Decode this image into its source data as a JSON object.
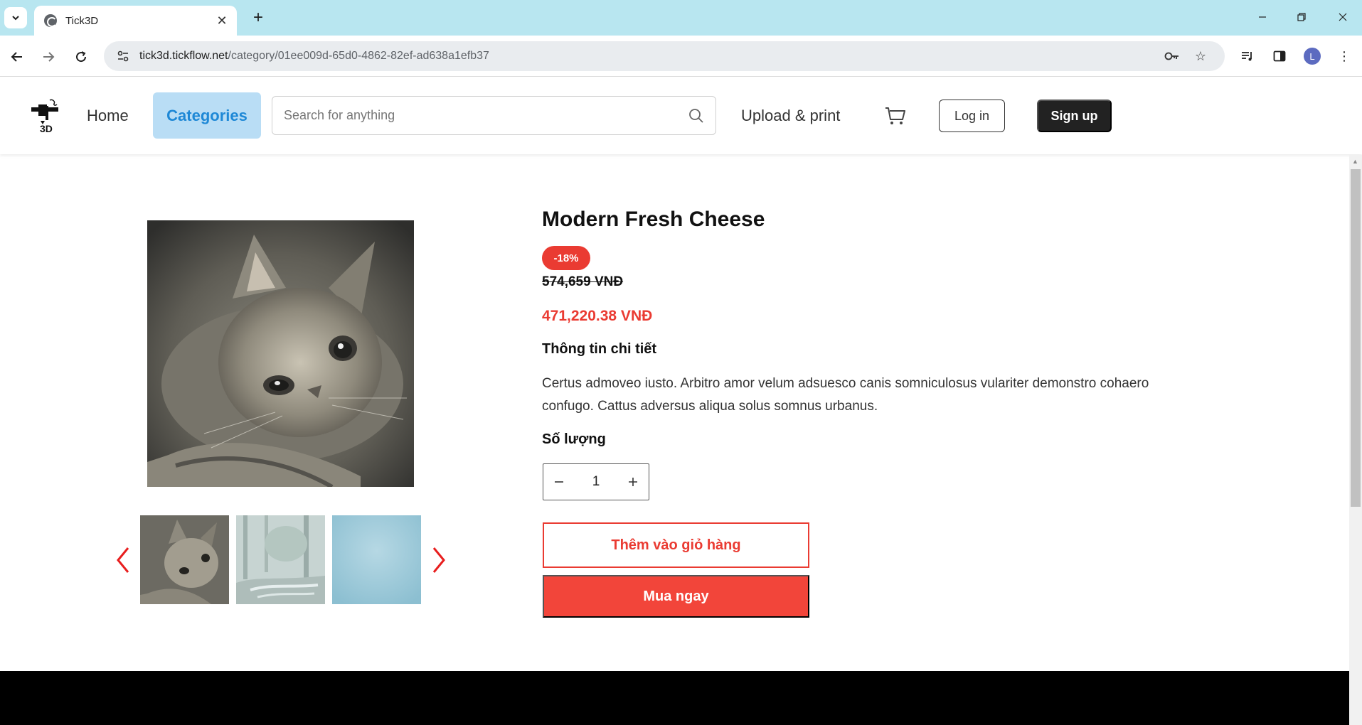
{
  "browser": {
    "tab_title": "Tick3D",
    "url_host": "tick3d.tickflow.net",
    "url_path": "/category/01ee009d-65d0-4862-82ef-ad638a1efb37",
    "profile_initial": "L"
  },
  "header": {
    "logo_text": "3D",
    "nav_home": "Home",
    "nav_categories": "Categories",
    "search_placeholder": "Search for anything",
    "upload_print": "Upload & print",
    "login": "Log in",
    "signup": "Sign up"
  },
  "product": {
    "title": "Modern Fresh Cheese",
    "discount_badge": "-18%",
    "old_price": "574,659 VNĐ",
    "new_price": "471,220.38 VNĐ",
    "detail_heading": "Thông tin chi tiết",
    "description": "Certus admoveo iusto. Arbitro amor velum adsuesco canis somniculosus vulariter demonstro cohaero confugo. Cattus adversus aliqua solus somnus urbanus.",
    "quantity_label": "Số lượng",
    "quantity_value": "1",
    "add_to_cart": "Thêm vào giỏ hàng",
    "buy_now": "Mua ngay",
    "main_image": "kitten-photo",
    "thumbnails": [
      "kitten-photo",
      "forest-stream-photo",
      "blue-water-photo"
    ]
  },
  "colors": {
    "accent_red": "#ea3b32",
    "category_active_bg": "#b9ddf5",
    "category_active_text": "#1e88d6",
    "chrome_tab_bar": "#b8e6f0"
  }
}
